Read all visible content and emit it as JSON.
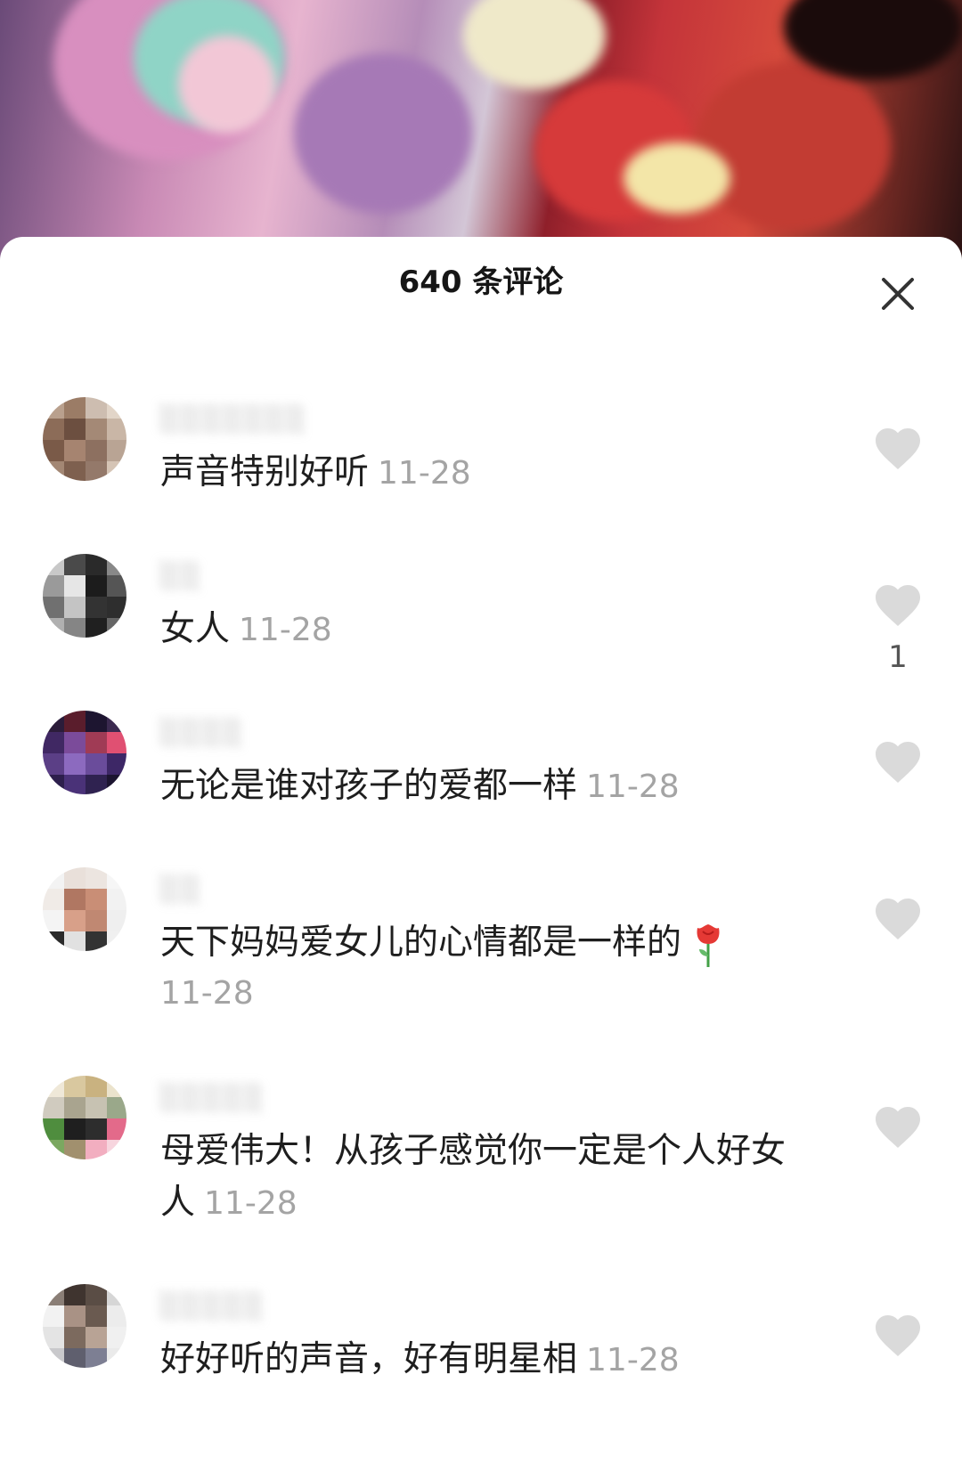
{
  "header": {
    "title": "640 条评论"
  },
  "comments": [
    {
      "username": "░░░░░░░",
      "text": "声音特别好听",
      "time": "11-28",
      "likes": ""
    },
    {
      "username": "░░",
      "text": "女人",
      "time": "11-28",
      "likes": "1"
    },
    {
      "username": "░░░░",
      "text": "无论是谁对孩子的爱都一样",
      "time": "11-28",
      "likes": ""
    },
    {
      "username": "░░",
      "text": "天下妈妈爱女儿的心情都是一样的",
      "time": "11-28",
      "likes": "",
      "emoji": "rose-icon"
    },
    {
      "username": "░░░░░",
      "text": "母爱伟大！从孩子感觉你一定是个人好女人",
      "time": "11-28",
      "likes": ""
    },
    {
      "username": "░░░░░",
      "text": "好好听的声音，好有明星相",
      "time": "11-28",
      "likes": ""
    }
  ],
  "colors": {
    "like_icon": "#dadada",
    "timestamp": "#a4a4a4",
    "text": "#1e1e1e"
  }
}
